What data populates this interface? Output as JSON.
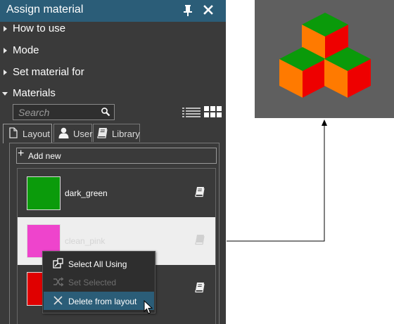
{
  "panel": {
    "title": "Assign material",
    "pin_icon": "pin-icon",
    "close_icon": "close-icon",
    "title_color": "#2b5d78"
  },
  "sections": [
    {
      "label": "How to use",
      "expanded": false
    },
    {
      "label": "Mode",
      "expanded": false
    },
    {
      "label": "Set material for",
      "expanded": false
    },
    {
      "label": "Materials",
      "expanded": true
    }
  ],
  "search": {
    "placeholder": "Search",
    "value": "",
    "icon": "search-icon"
  },
  "view_icons": [
    "view-list-icon",
    "view-grid-icon"
  ],
  "tabs": [
    {
      "label": "Layout",
      "icon": "document-icon",
      "active": true
    },
    {
      "label": "User",
      "icon": "user-icon",
      "active": false
    },
    {
      "label": "Library",
      "icon": "book-icon",
      "active": false
    }
  ],
  "add_new_label": "Add new",
  "materials": [
    {
      "name": "dark_green",
      "color": "#0b9b0b",
      "selected": false
    },
    {
      "name": "clean_pink",
      "color": "#ee44cc",
      "selected": true
    },
    {
      "name": "",
      "color": "#e00000",
      "selected": false
    }
  ],
  "context_menu": {
    "items": [
      {
        "label": "Select All Using",
        "icon": "select-all-icon",
        "enabled": true,
        "hover": false
      },
      {
        "label": "Set Selected",
        "icon": "shuffle-icon",
        "enabled": false,
        "hover": false
      },
      {
        "label": "Delete from layout",
        "icon": "delete-icon",
        "enabled": true,
        "hover": true
      }
    ]
  },
  "preview": {
    "background": "#5f5f5f",
    "cube_colors": {
      "top": "#0a9a0a",
      "left": "#ff7a00",
      "right": "#ee0000"
    }
  }
}
